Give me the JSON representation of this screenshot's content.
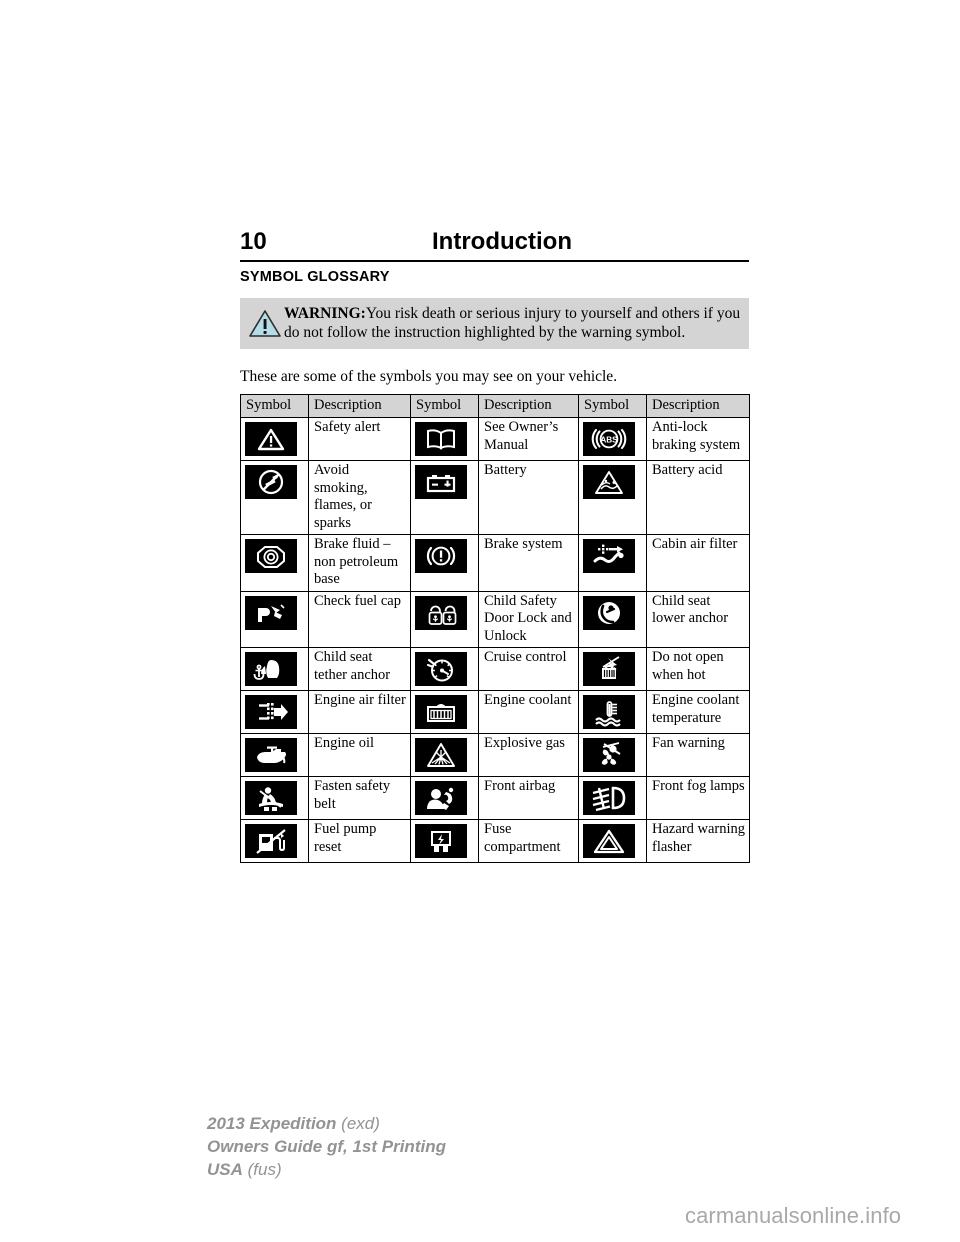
{
  "header": {
    "page_number": "10",
    "title": "Introduction"
  },
  "section": {
    "heading": "SYMBOL GLOSSARY"
  },
  "warning": {
    "label": "WARNING:",
    "text": "You risk death or serious injury to yourself and others if you do not follow the instruction highlighted by the warning symbol.",
    "icon": "warning-triangle-icon",
    "background_color": "#d4d4d4",
    "triangle_fill": "#b5dde8"
  },
  "intro": {
    "text": "These are some of the symbols you may see on your vehicle."
  },
  "table": {
    "headers": [
      "Symbol",
      "Description",
      "Symbol",
      "Description",
      "Symbol",
      "Description"
    ],
    "header_background": "#d4d4d4",
    "rows": [
      [
        {
          "icon": "safety-alert-icon",
          "label": "Safety alert"
        },
        {
          "icon": "owners-manual-icon",
          "label": "See Owner’s Manual"
        },
        {
          "icon": "abs-icon",
          "label": "Anti-lock braking system"
        }
      ],
      [
        {
          "icon": "no-smoking-flames-sparks-icon",
          "label": "Avoid smoking, flames, or sparks"
        },
        {
          "icon": "battery-icon",
          "label": "Battery"
        },
        {
          "icon": "battery-acid-icon",
          "label": "Battery acid"
        }
      ],
      [
        {
          "icon": "brake-fluid-icon",
          "label": "Brake fluid – non petroleum base"
        },
        {
          "icon": "brake-system-icon",
          "label": "Brake system"
        },
        {
          "icon": "cabin-air-filter-icon",
          "label": "Cabin air filter"
        }
      ],
      [
        {
          "icon": "check-fuel-cap-icon",
          "label": "Check fuel cap"
        },
        {
          "icon": "child-safety-door-lock-icon",
          "label": "Child Safety Door Lock and Unlock"
        },
        {
          "icon": "child-seat-lower-anchor-icon",
          "label": "Child seat lower anchor"
        }
      ],
      [
        {
          "icon": "child-seat-tether-anchor-icon",
          "label": "Child seat tether anchor"
        },
        {
          "icon": "cruise-control-icon",
          "label": "Cruise control"
        },
        {
          "icon": "do-not-open-when-hot-icon",
          "label": "Do not open when hot"
        }
      ],
      [
        {
          "icon": "engine-air-filter-icon",
          "label": "Engine air filter"
        },
        {
          "icon": "engine-coolant-icon",
          "label": "Engine coolant"
        },
        {
          "icon": "engine-coolant-temperature-icon",
          "label": "Engine coolant temperature"
        }
      ],
      [
        {
          "icon": "engine-oil-icon",
          "label": "Engine oil"
        },
        {
          "icon": "explosive-gas-icon",
          "label": "Explosive gas"
        },
        {
          "icon": "fan-warning-icon",
          "label": "Fan warning"
        }
      ],
      [
        {
          "icon": "fasten-safety-belt-icon",
          "label": "Fasten safety belt"
        },
        {
          "icon": "front-airbag-icon",
          "label": "Front airbag"
        },
        {
          "icon": "front-fog-lamps-icon",
          "label": "Front fog lamps"
        }
      ],
      [
        {
          "icon": "fuel-pump-reset-icon",
          "label": "Fuel pump reset"
        },
        {
          "icon": "fuse-compartment-icon",
          "label": "Fuse compartment"
        },
        {
          "icon": "hazard-warning-flasher-icon",
          "label": "Hazard warning flasher"
        }
      ]
    ]
  },
  "footer": {
    "line1_bold": "2013 Expedition",
    "line1_light": " (exd)",
    "line2_bold": "Owners Guide gf, 1st Printing",
    "line3_bold": "USA",
    "line3_light": " (fus)",
    "color": "#939393"
  },
  "watermark": {
    "text": "carmanualsonline.info",
    "color": "#a8a8a8"
  }
}
